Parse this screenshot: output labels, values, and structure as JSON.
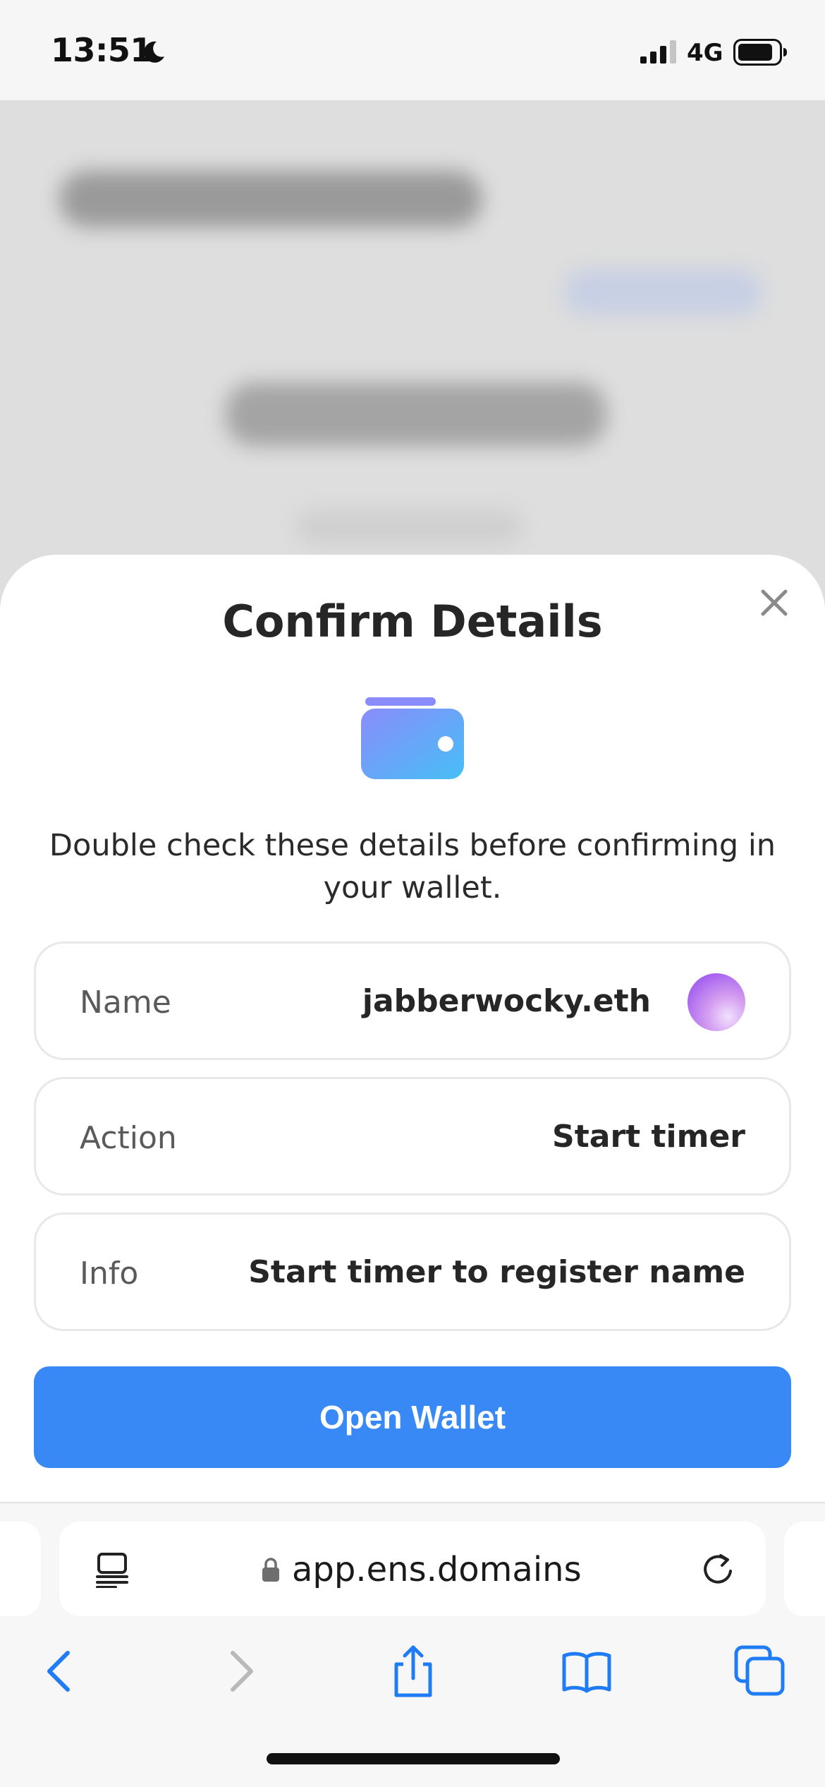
{
  "status_bar": {
    "time": "13:51",
    "network": "4G",
    "icons": [
      "moon-icon",
      "signal-icon",
      "battery-icon"
    ]
  },
  "modal": {
    "title": "Confirm Details",
    "description": "Double check these details before confirming in your wallet.",
    "icons": [
      "close-icon",
      "wallet-icon"
    ],
    "details": [
      {
        "label": "Name",
        "value": "jabberwocky.eth",
        "has_avatar": true
      },
      {
        "label": "Action",
        "value": "Start timer"
      },
      {
        "label": "Info",
        "value": "Start timer to register name"
      }
    ],
    "primary_button": "Open Wallet"
  },
  "browser": {
    "url": "app.ens.domains",
    "icons": [
      "reader-icon",
      "lock-icon",
      "reload-icon",
      "back-icon",
      "forward-icon",
      "share-icon",
      "bookmarks-icon",
      "tabs-icon"
    ]
  },
  "colors": {
    "accent": "#3889f6",
    "wallet_gradient_start": "#8a8cfb",
    "wallet_gradient_end": "#46bff5",
    "safari_blue": "#1f7cf5"
  }
}
